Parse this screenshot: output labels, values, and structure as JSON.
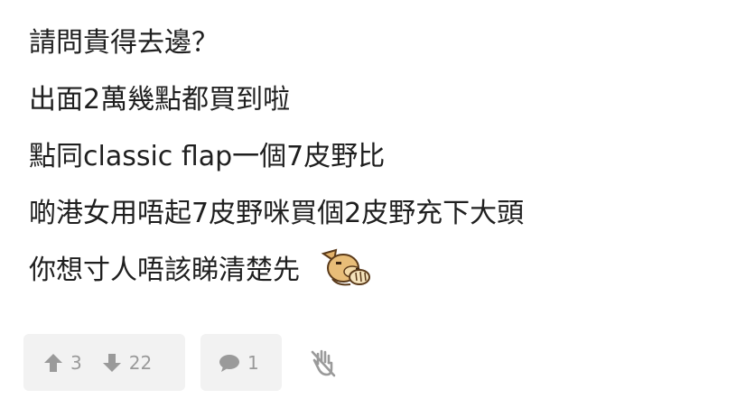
{
  "post": {
    "lines": [
      "請問貴得去邊？",
      "出面2萬幾點都買到啦",
      "點同classic flap一個7皮野比",
      "啲港女用唔起7皮野咪買個2皮野充下大頭",
      "你想寸人唔該睇清楚先"
    ],
    "emoji_icon": "facepalm-dog-emoji"
  },
  "actions": {
    "upvote_count": "3",
    "downvote_count": "22",
    "reply_count": "1",
    "icon_color": "#9a9a9a",
    "pill_bg": "#f2f2f2"
  }
}
